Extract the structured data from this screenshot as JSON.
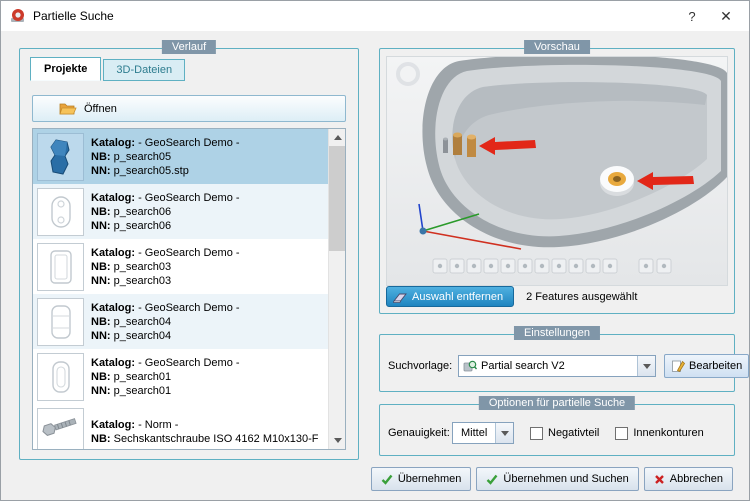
{
  "window": {
    "title": "Partielle Suche",
    "help_label": "?",
    "close_label": "✕"
  },
  "verlauf": {
    "group_label": "Verlauf",
    "tabs": {
      "projekte": "Projekte",
      "dateien": "3D-Dateien"
    },
    "open_button": "Öffnen",
    "items": [
      {
        "l1_label": "Katalog:",
        "l1": "- GeoSearch Demo -",
        "l2_label": "NB:",
        "l2": "p_search05",
        "l3_label": "NN:",
        "l3": "p_search05.stp",
        "selected": true
      },
      {
        "l1_label": "Katalog:",
        "l1": "- GeoSearch Demo -",
        "l2_label": "NB:",
        "l2": "p_search06",
        "l3_label": "NN:",
        "l3": "p_search06",
        "selected": false
      },
      {
        "l1_label": "Katalog:",
        "l1": "- GeoSearch Demo -",
        "l2_label": "NB:",
        "l2": "p_search03",
        "l3_label": "NN:",
        "l3": "p_search03",
        "selected": false
      },
      {
        "l1_label": "Katalog:",
        "l1": "- GeoSearch Demo -",
        "l2_label": "NB:",
        "l2": "p_search04",
        "l3_label": "NN:",
        "l3": "p_search04",
        "selected": false
      },
      {
        "l1_label": "Katalog:",
        "l1": "- GeoSearch Demo -",
        "l2_label": "NB:",
        "l2": "p_search01",
        "l3_label": "NN:",
        "l3": "p_search01",
        "selected": false
      },
      {
        "l1_label": "Katalog:",
        "l1": "- Norm -",
        "l2_label": "NB:",
        "l2": "Sechskantschraube ISO 4162 M10x130-F",
        "selected": false
      }
    ]
  },
  "vorschau": {
    "group_label": "Vorschau",
    "remove_selection_button": "Auswahl entfernen",
    "status_text": "2 Features ausgewählt"
  },
  "einstellungen": {
    "group_label": "Einstellungen",
    "template_label": "Suchvorlage:",
    "template_value": "Partial search V2",
    "edit_button": "Bearbeiten"
  },
  "optionen": {
    "group_label": "Optionen für partielle Suche",
    "accuracy_label": "Genauigkeit:",
    "accuracy_value": "Mittel",
    "checkbox_negativteil": "Negativteil",
    "checkbox_innenkonturen": "Innenkonturen",
    "negativteil_checked": false,
    "innenkonturen_checked": false
  },
  "footer": {
    "apply_button": "Übernehmen",
    "apply_search_button": "Übernehmen und Suchen",
    "cancel_button": "Abbrechen"
  },
  "icons": {
    "open": "folder-open-icon",
    "remove": "eraser-icon",
    "edit": "pencil-icon",
    "apply": "check-icon",
    "cancel": "cross-icon",
    "combo": "chevron-down-icon"
  },
  "colors": {
    "group_border": "#5fb0c2",
    "group_label_bg": "#8096a8",
    "selected_row": "#aed2e6",
    "primary_button": "#1f85c0",
    "apply_icon_green": "#3aa03a",
    "cancel_icon_red": "#cc2222",
    "arrow_red": "#e22718"
  }
}
